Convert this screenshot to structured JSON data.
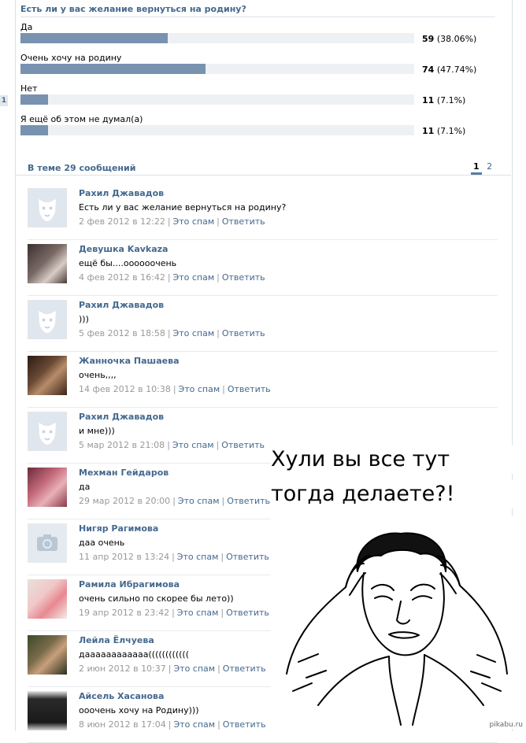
{
  "poll": {
    "title": "Есть ли у вас желание вернуться на родину?",
    "options": [
      {
        "label": "Да",
        "count": "59",
        "pct": "(38.06%)",
        "fraction": 0.3806
      },
      {
        "label": "Очень хочу на родину",
        "count": "74",
        "pct": "(47.74%)",
        "fraction": 0.4774
      },
      {
        "label": "Нет",
        "count": "11",
        "pct": "(7.1%)",
        "fraction": 0.071
      },
      {
        "label": "Я ещё об этом не думал(а)",
        "count": "11",
        "pct": "(7.1%)",
        "fraction": 0.071
      }
    ]
  },
  "left_tab": "1",
  "thread": {
    "header": "В теме 29 сообщений",
    "pages": [
      "1",
      "2"
    ],
    "active_page": "1"
  },
  "posts": [
    {
      "author": "Рахил Джавадов",
      "text": "Есть ли у вас желание вернуться на родину?",
      "date": "2 фев 2012 в 12:22",
      "spam": "Это спам",
      "reply": "Ответить",
      "avatar": "default-dog-icon"
    },
    {
      "author": "Девушка Kavkaza",
      "text": "ещё бы....оооооочень",
      "date": "4 фев 2012 в 16:42",
      "spam": "Это спам",
      "reply": "Ответить",
      "avatar": "photo-girl"
    },
    {
      "author": "Рахил Джавадов",
      "text": ")))",
      "date": "5 фев 2012 в 18:58",
      "spam": "Это спам",
      "reply": "Ответить",
      "avatar": "default-dog-icon"
    },
    {
      "author": "Жанночка Пашаева",
      "text": "очень,,,,",
      "date": "14 фев 2012 в 10:38",
      "spam": "Это спам",
      "reply": "Ответить",
      "avatar": "photo-dark"
    },
    {
      "author": "Рахил Джавадов",
      "text": "и мне)))",
      "date": "5 мар 2012 в 21:08",
      "spam": "Это спам",
      "reply": "Ответить",
      "avatar": "default-dog-icon"
    },
    {
      "author": "Мехман Гейдаров",
      "text": "да",
      "date": "29 мар 2012 в 20:00",
      "spam": "Это спам",
      "reply": "Ответить",
      "avatar": "photo-pink"
    },
    {
      "author": "Нигяр Рагимова",
      "text": "даа очень",
      "date": "11 апр 2012 в 13:24",
      "spam": "Это спам",
      "reply": "Ответить",
      "avatar": "camera-icon"
    },
    {
      "author": "Рамила Ибрагимова",
      "text": "очень сильно по скорее бы лето))",
      "date": "19 апр 2012 в 23:42",
      "spam": "Это спам",
      "reply": "Ответить",
      "avatar": "photo-flowers"
    },
    {
      "author": "Лейла Ёлчуева",
      "text": "даааааааааааа((((((((((((",
      "date": "2 июн 2012 в 10:37",
      "spam": "Это спам",
      "reply": "Ответить",
      "avatar": "photo-woman"
    },
    {
      "author": "Айсель Хасанова",
      "text": "ооочень хочу на Родину)))",
      "date": "8 июн 2012 в 17:04",
      "spam": "Это спам",
      "reply": "Ответить",
      "avatar": "photo-monument"
    }
  ],
  "meme": {
    "line1": "Хули вы все тут",
    "line2": "тогда делаете?!",
    "face": "jackie-chan-meme-face"
  },
  "watermark": "pikabu.ru",
  "colors": {
    "link": "#45688e",
    "bar": "#7892b0",
    "track": "#eef1f4",
    "meta": "#999999"
  }
}
